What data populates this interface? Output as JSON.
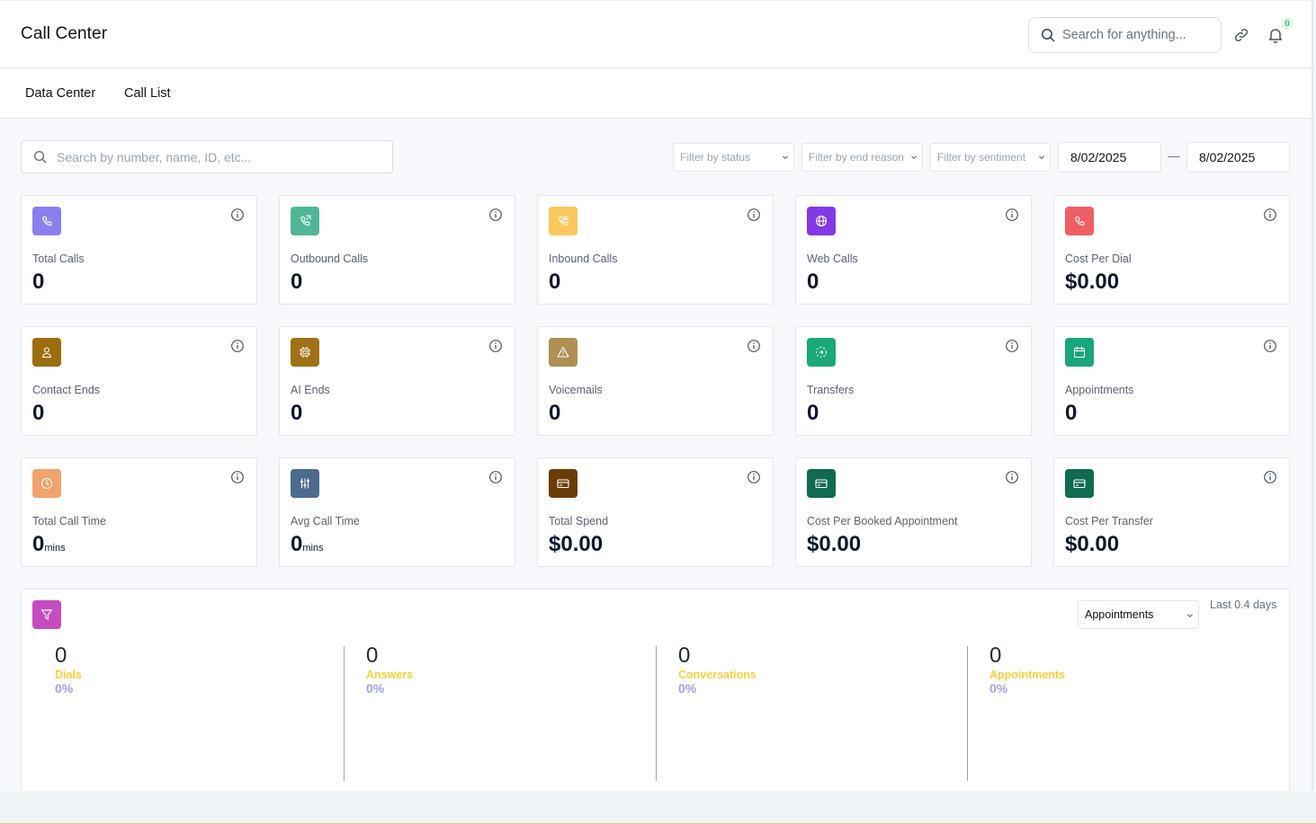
{
  "header": {
    "title": "Call Center",
    "search_placeholder": "Search for anything...",
    "notification_count": "0"
  },
  "tabs": [
    {
      "label": "Data Center"
    },
    {
      "label": "Call List"
    }
  ],
  "toolbar": {
    "search_placeholder": "Search by number, name, ID, etc...",
    "filters": [
      {
        "label": "Filter by status"
      },
      {
        "label": "Filter by end reason"
      },
      {
        "label": "Filter by sentiment"
      }
    ],
    "date_from": "8/02/2025",
    "date_to": "8/02/2025",
    "date_separator": "—"
  },
  "cards": [
    {
      "label": "Total Calls",
      "value": "0",
      "unit": "",
      "icon": "phone-icon",
      "color": "#8b7ff0"
    },
    {
      "label": "Outbound Calls",
      "value": "0",
      "unit": "",
      "icon": "phone-outgoing-icon",
      "color": "#4fb797"
    },
    {
      "label": "Inbound Calls",
      "value": "0",
      "unit": "",
      "icon": "phone-incoming-icon",
      "color": "#fbc75c"
    },
    {
      "label": "Web Calls",
      "value": "0",
      "unit": "",
      "icon": "globe-icon",
      "color": "#8438e6"
    },
    {
      "label": "Cost Per Dial",
      "value": "$0.00",
      "unit": "",
      "icon": "phone-icon",
      "color": "#ef5e63"
    },
    {
      "label": "Contact Ends",
      "value": "0",
      "unit": "",
      "icon": "user-icon",
      "color": "#9b6d0e"
    },
    {
      "label": "AI Ends",
      "value": "0",
      "unit": "",
      "icon": "chip-icon",
      "color": "#a07216"
    },
    {
      "label": "Voicemails",
      "value": "0",
      "unit": "",
      "icon": "warning-icon",
      "color": "#b08f52"
    },
    {
      "label": "Transfers",
      "value": "0",
      "unit": "",
      "icon": "transfer-icon",
      "color": "#1aa87a"
    },
    {
      "label": "Appointments",
      "value": "0",
      "unit": "",
      "icon": "calendar-icon",
      "color": "#18a77c"
    },
    {
      "label": "Total Call Time",
      "value": "0",
      "unit": "mins",
      "icon": "clock-icon",
      "color": "#f1a36d"
    },
    {
      "label": "Avg Call Time",
      "value": "0",
      "unit": "mins",
      "icon": "sliders-icon",
      "color": "#4d6b8e"
    },
    {
      "label": "Total Spend",
      "value": "$0.00",
      "unit": "",
      "icon": "credit-card-icon",
      "color": "#6b3d06"
    },
    {
      "label": "Cost Per Booked Appointment",
      "value": "$0.00",
      "unit": "",
      "icon": "credit-card-icon",
      "color": "#0f6b52"
    },
    {
      "label": "Cost Per Transfer",
      "value": "$0.00",
      "unit": "",
      "icon": "credit-card-icon",
      "color": "#0f6b52"
    }
  ],
  "funnel": {
    "selected": "Appointments",
    "range": "Last 0.4 days",
    "icon_color": "#c54cc0",
    "stages": [
      {
        "value": "0",
        "label": "Dials",
        "percent": "0%"
      },
      {
        "value": "0",
        "label": "Answers",
        "percent": "0%"
      },
      {
        "value": "0",
        "label": "Conversations",
        "percent": "0%"
      },
      {
        "value": "0",
        "label": "Appointments",
        "percent": "0%"
      }
    ]
  }
}
